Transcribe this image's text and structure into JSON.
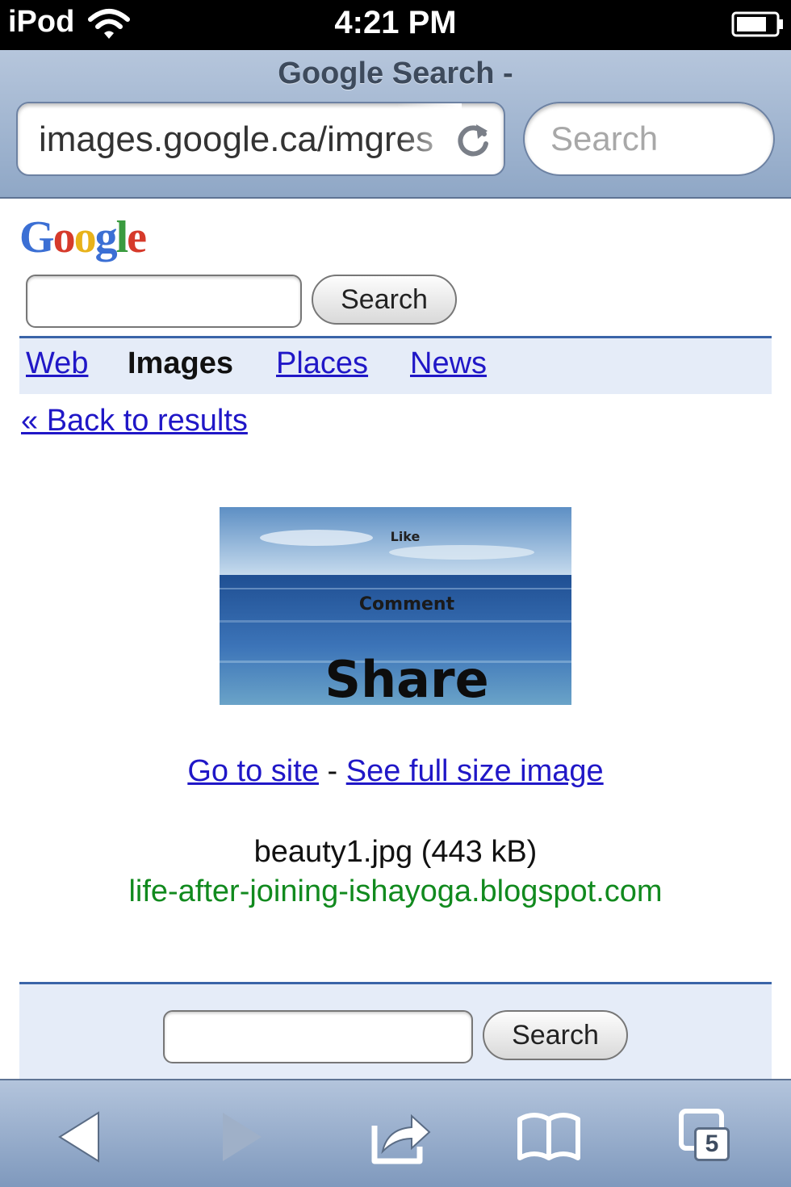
{
  "status_bar": {
    "device": "iPod",
    "time": "4:21 PM"
  },
  "browser": {
    "page_title": "Google Search -",
    "url": "images.google.ca/imgres",
    "search_placeholder": "Search"
  },
  "google": {
    "logo_letters": [
      "G",
      "o",
      "o",
      "g",
      "l",
      "e"
    ],
    "search_button": "Search",
    "nav": {
      "web": "Web",
      "images": "Images",
      "places": "Places",
      "news": "News"
    },
    "back_link": "« Back to results"
  },
  "image_result": {
    "thumb_texts": [
      "Like",
      "Comment",
      "Share"
    ],
    "go_to_site": "Go to site",
    "separator": "-",
    "full_size": "See full size image",
    "file_info": "beauty1.jpg (443 kB)",
    "source": "life-after-joining-ishayoga.blogspot.com"
  },
  "bottom_form": {
    "search_button": "Search"
  },
  "toolbar": {
    "tabs_count": "5",
    "icons": [
      "back-icon",
      "forward-icon",
      "share-icon",
      "bookmarks-icon",
      "tabs-icon"
    ]
  },
  "colors": {
    "link": "#2017c7",
    "source_green": "#118a1e",
    "nav_bar": "#e5ecf8",
    "accent_border": "#3a64a8"
  }
}
